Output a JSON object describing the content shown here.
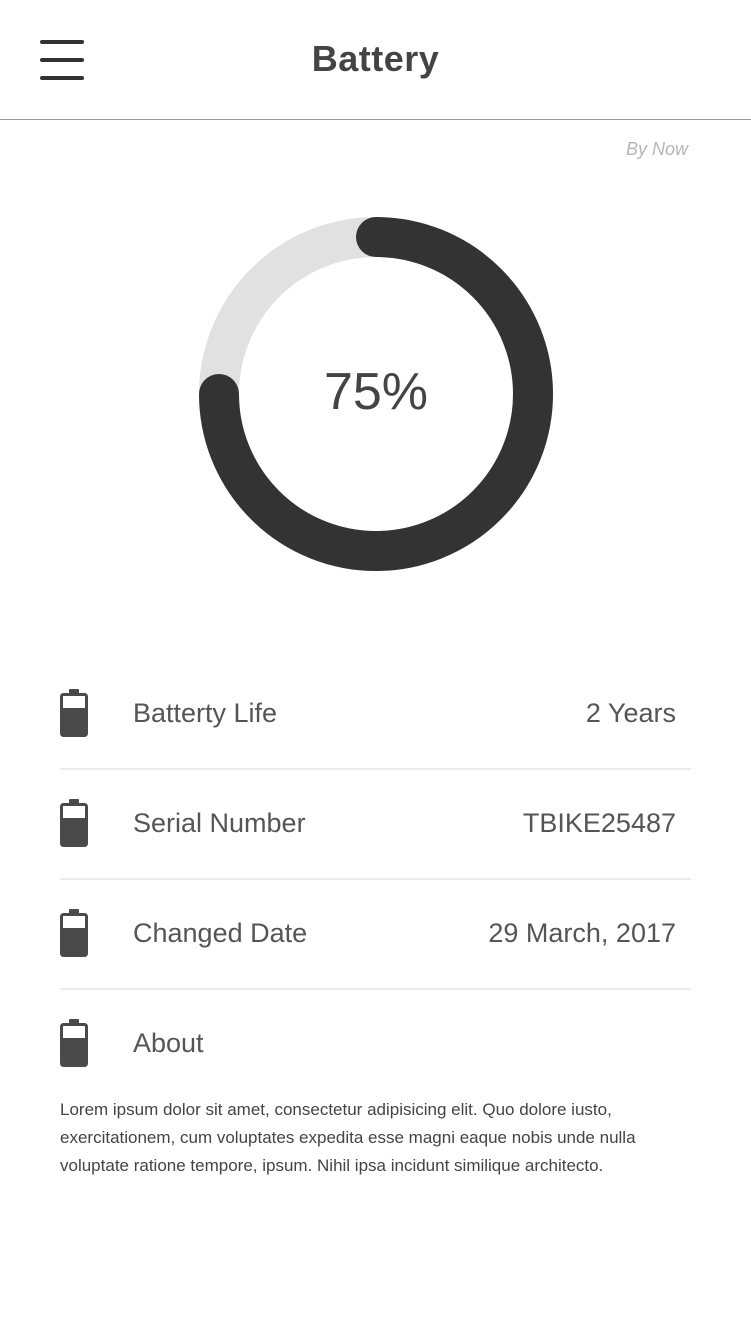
{
  "header": {
    "title": "Battery",
    "menu_icon": "hamburger-menu-icon"
  },
  "gauge": {
    "caption": "By Now",
    "percent": 75,
    "label": "75%",
    "colors": {
      "fill": "#333333",
      "track": "#e1e1e1"
    }
  },
  "info": {
    "items": [
      {
        "label": "Batterty Life",
        "value": "2 Years",
        "icon": "battery-icon"
      },
      {
        "label": "Serial Number",
        "value": "TBIKE25487",
        "icon": "battery-icon"
      },
      {
        "label": "Changed Date",
        "value": "29 March, 2017",
        "icon": "battery-icon"
      },
      {
        "label": "About",
        "value": "",
        "icon": "battery-icon"
      }
    ]
  },
  "about": {
    "text": "Lorem ipsum dolor sit amet, consectetur adipisicing elit. Quo dolore iusto, exercitationem, cum voluptates expedita esse magni eaque nobis unde nulla voluptate ratione tempore, ipsum. Nihil ipsa incidunt similique architecto."
  }
}
